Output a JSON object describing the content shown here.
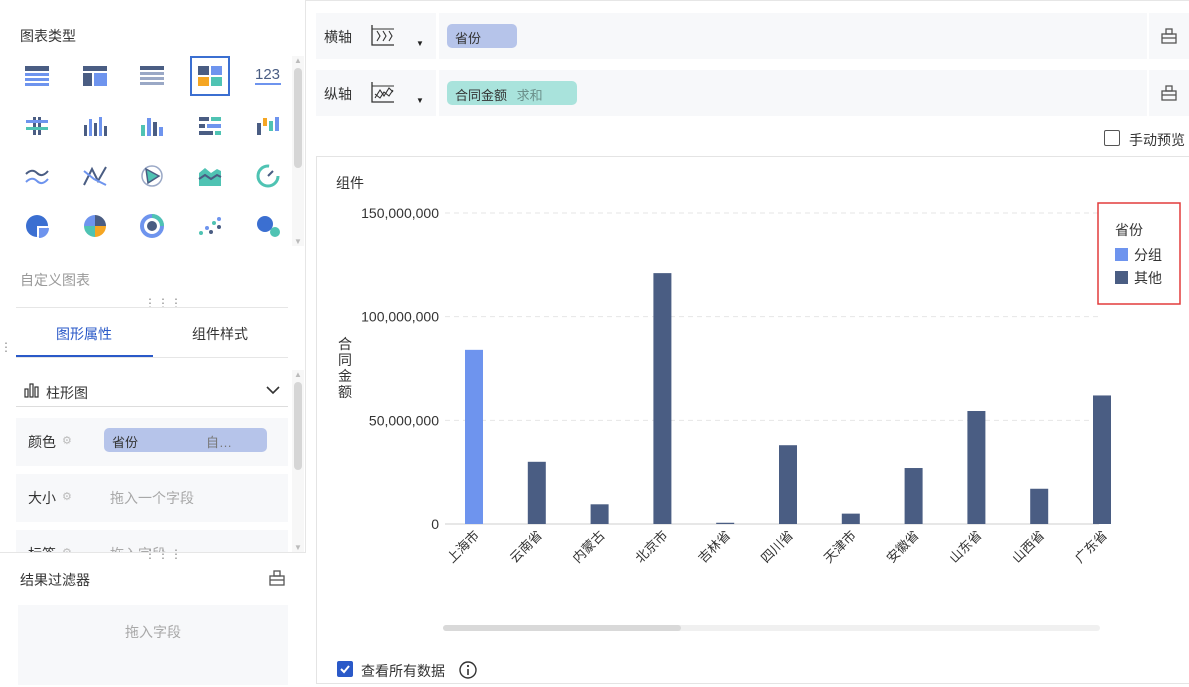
{
  "left": {
    "chart_type_title": "图表类型",
    "custom_chart": "自定义图表",
    "tabs": [
      {
        "label": "图形属性"
      },
      {
        "label": "组件样式"
      }
    ],
    "chart_kind": "柱形图",
    "props": {
      "color_label": "颜色",
      "color_field": "省份",
      "color_field_extra": "自…",
      "size_label": "大小",
      "size_placeholder": "拖入一个字段",
      "tag_label": "标签",
      "tag_placeholder": "拖入字段"
    },
    "filter_title": "结果过滤器",
    "filter_placeholder": "拖入字段"
  },
  "axes": {
    "x_label": "横轴",
    "x_field": "省份",
    "y_label": "纵轴",
    "y_field": "合同金额",
    "y_agg": "求和"
  },
  "manual_preview": "手动预览",
  "view_all_data": "查看所有数据",
  "colors": {
    "accent": "#2a59c8",
    "series_group": "#6e94ee",
    "series_other": "#4a5d83",
    "x_pill": "#b6c4ea",
    "y_pill": "#a9e3dc",
    "legend_border": "#e23b3b"
  },
  "chart_data": {
    "type": "bar",
    "title": "组件",
    "ylabel": "合同金额",
    "xlabel": "",
    "ylim": [
      0,
      150000000
    ],
    "yticks": [
      0,
      50000000,
      100000000,
      150000000
    ],
    "ytick_labels": [
      "0",
      "50,000,000",
      "100,000,000",
      "150,000,000"
    ],
    "categories": [
      "上海市",
      "云南省",
      "内蒙古",
      "北京市",
      "吉林省",
      "四川省",
      "天津市",
      "安徽省",
      "山东省",
      "山西省",
      "广东省"
    ],
    "values": [
      84000000,
      30000000,
      9500000,
      121000000,
      600000,
      38000000,
      5000000,
      27000000,
      54500000,
      17000000,
      62000000
    ],
    "groups": [
      "分组",
      "其他",
      "其他",
      "其他",
      "其他",
      "其他",
      "其他",
      "其他",
      "其他",
      "其他",
      "其他"
    ],
    "legend_title": "省份",
    "legend": [
      {
        "name": "分组",
        "color": "#6e94ee"
      },
      {
        "name": "其他",
        "color": "#4a5d83"
      }
    ],
    "grid": true,
    "legend_position": "top-right"
  }
}
